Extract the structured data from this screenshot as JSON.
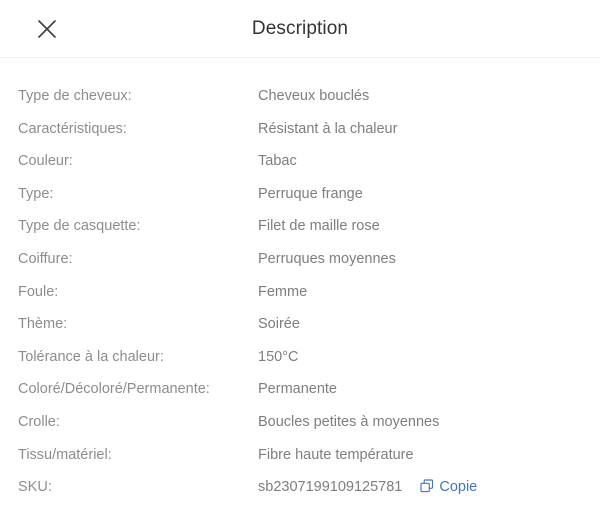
{
  "header": {
    "title": "Description",
    "close_icon": "close-icon"
  },
  "colors": {
    "label_text": "#8d8d8d",
    "value_text": "#7e7e7e",
    "title_text": "#333333",
    "accent_blue": "#4276bf",
    "divider": "#f0f0f0",
    "background": "#ffffff"
  },
  "specs": [
    {
      "label": "Type de cheveux:",
      "value": "Cheveux bouclés"
    },
    {
      "label": "Caractéristiques:",
      "value": "Résistant à la chaleur"
    },
    {
      "label": "Couleur:",
      "value": "Tabac"
    },
    {
      "label": "Type:",
      "value": "Perruque frange"
    },
    {
      "label": "Type de casquette:",
      "value": "Filet de maille rose"
    },
    {
      "label": "Coiffure:",
      "value": "Perruques moyennes"
    },
    {
      "label": "Foule:",
      "value": "Femme"
    },
    {
      "label": "Thème:",
      "value": "Soirée"
    },
    {
      "label": "Tolérance à la chaleur:",
      "value": "150°C"
    },
    {
      "label": "Coloré/Décoloré/Permanente:",
      "value": "Permanente"
    },
    {
      "label": "Crolle:",
      "value": "Boucles petites à moyennes"
    },
    {
      "label": "Tissu/matériel:",
      "value": "Fibre haute température"
    }
  ],
  "sku": {
    "label": "SKU:",
    "value": "sb2307199109125781",
    "copy_label": "Copie",
    "copy_icon": "copy-icon"
  }
}
